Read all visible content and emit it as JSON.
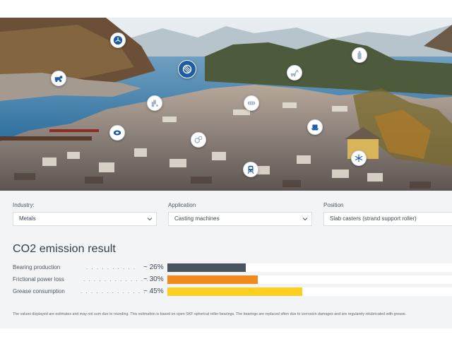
{
  "hero": {
    "hotspots": [
      {
        "name": "wind-turbine-icon"
      },
      {
        "name": "construction-vehicle-icon"
      },
      {
        "name": "steel-coil-icon",
        "active": true
      },
      {
        "name": "bottle-icon"
      },
      {
        "name": "excavator-icon"
      },
      {
        "name": "tractor-icon"
      },
      {
        "name": "roller-icon"
      },
      {
        "name": "paper-roll-icon"
      },
      {
        "name": "ship-icon"
      },
      {
        "name": "factory-icon"
      },
      {
        "name": "gears-icon"
      },
      {
        "name": "train-icon"
      },
      {
        "name": "fan-icon"
      }
    ]
  },
  "form": {
    "industry": {
      "label": "Industry:",
      "value": "Metals"
    },
    "application": {
      "label": "Application",
      "value": "Casting machines"
    },
    "position": {
      "label": "Position",
      "value": "Slab casters (strand support roller)"
    }
  },
  "result": {
    "title": "CO2 emission result",
    "rows": [
      {
        "label": "Bearing production",
        "dots": ". . . . . . . . . .",
        "pct_text": "~ 26%",
        "value": 0.26,
        "color": "#4a545e"
      },
      {
        "label": "Frictional power loss",
        "dots": ". . . . . . . . . . . . .",
        "pct_text": "~ 30%",
        "value": 0.3,
        "color": "#f08a1c"
      },
      {
        "label": "Grease consumption",
        "dots": ". . . . . . . . . . . . . .",
        "pct_text": "~ 45%",
        "value": 0.45,
        "color": "#fdd020"
      }
    ],
    "footnote": "The values displayed are estimates and may not sum due to rounding. This estimation is based on open SKF spherical roller bearings. The bearings are replaced often due to corrosion damages and are regularely relubricated with grease."
  }
}
